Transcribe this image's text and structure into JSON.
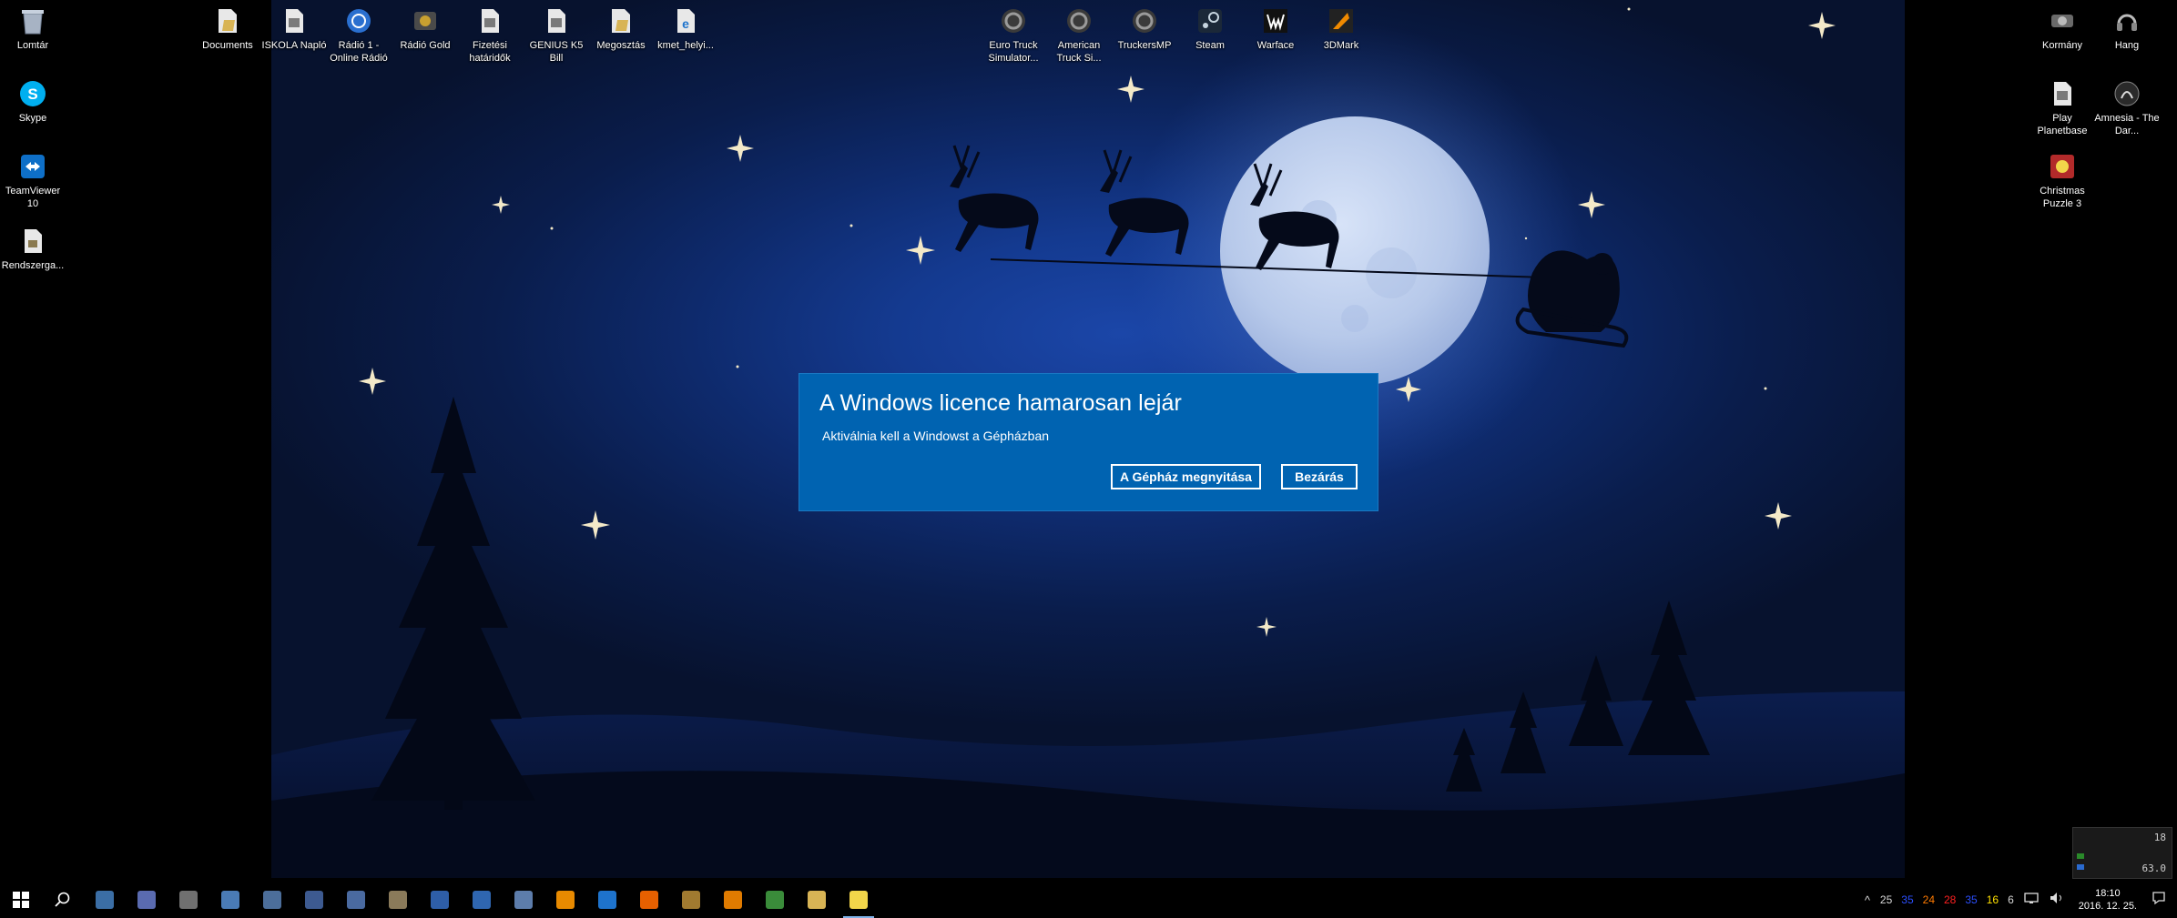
{
  "dialog": {
    "title": "A Windows licence hamarosan lejár",
    "message": "Aktiválnia kell a Windowst a Gépházban",
    "open_settings_label": "A Gépház megnyitása",
    "close_label": "Bezárás",
    "bg_color": "#0063b1"
  },
  "desktop_icons_left": [
    {
      "label": "Lomtár",
      "icon": "recycle-bin-icon"
    },
    {
      "label": "Skype",
      "icon": "skype-icon"
    },
    {
      "label": "TeamViewer 10",
      "icon": "teamviewer-icon"
    },
    {
      "label": "Rendszerga...",
      "icon": "shortcut-icon"
    }
  ],
  "desktop_icons_top": [
    {
      "label": "Documents",
      "icon": "folder-icon"
    },
    {
      "label": "ISKOLA Napló",
      "icon": "document-icon"
    },
    {
      "label": "Rádió 1 - Online Rádió",
      "icon": "radio-icon"
    },
    {
      "label": "Rádió Gold",
      "icon": "radio-icon"
    },
    {
      "label": "Fizetési határidők",
      "icon": "document-icon"
    },
    {
      "label": "GENIUS K5 Bill",
      "icon": "document-icon"
    },
    {
      "label": "Megosztás",
      "icon": "folder-icon"
    },
    {
      "label": "kmet_helyi...",
      "icon": "web-document-icon"
    }
  ],
  "desktop_icons_games": [
    {
      "label": "Euro Truck Simulator...",
      "icon": "steam-game-icon"
    },
    {
      "label": "American Truck Si...",
      "icon": "steam-game-icon"
    },
    {
      "label": "TruckersMP",
      "icon": "steam-game-icon"
    },
    {
      "label": "Steam",
      "icon": "steam-icon"
    },
    {
      "label": "Warface",
      "icon": "warface-icon"
    },
    {
      "label": "3DMark",
      "icon": "3dmark-icon"
    }
  ],
  "desktop_icons_right": [
    {
      "label": "Kormány",
      "icon": "steering-wheel-icon"
    },
    {
      "label": "Hang",
      "icon": "headset-icon"
    },
    {
      "label": "Play Planetbase",
      "icon": "document-icon"
    },
    {
      "label": "Amnesia - The Dar...",
      "icon": "amnesia-icon"
    },
    {
      "label": "Christmas Puzzle 3",
      "icon": "christmas-puzzle-icon"
    }
  ],
  "taskbar": {
    "apps": [
      {
        "name": "file-explorer-app",
        "color": "#3b6ea5"
      },
      {
        "name": "save-app",
        "color": "#5a6bb0"
      },
      {
        "name": "calculator-app",
        "color": "#707070"
      },
      {
        "name": "control-panel-app",
        "color": "#4a7bb5"
      },
      {
        "name": "pictures-app",
        "color": "#4c6e9a"
      },
      {
        "name": "gallery-app",
        "color": "#3d5a90"
      },
      {
        "name": "photos-app",
        "color": "#4a6aa0"
      },
      {
        "name": "archive-app",
        "color": "#8a7a5a"
      },
      {
        "name": "dictionary-app",
        "color": "#2e5ea8"
      },
      {
        "name": "music-app",
        "color": "#2f66b0"
      },
      {
        "name": "disk-app",
        "color": "#5d7dab"
      },
      {
        "name": "vlc-app",
        "color": "#e88a00"
      },
      {
        "name": "edge-app",
        "color": "#1e73cc"
      },
      {
        "name": "firefox-app",
        "color": "#e66000"
      },
      {
        "name": "gimp-app",
        "color": "#a07a30"
      },
      {
        "name": "avast-app",
        "color": "#e07b00"
      },
      {
        "name": "chrome-app",
        "color": "#3a8c3a"
      },
      {
        "name": "folder-app",
        "color": "#d8b455"
      },
      {
        "name": "sticky-notes-app",
        "color": "#f2d64a"
      }
    ],
    "tray_numbers": [
      {
        "value": "25",
        "color": "#d8d8d8"
      },
      {
        "value": "35",
        "color": "#2b4fff"
      },
      {
        "value": "24",
        "color": "#ff7a00"
      },
      {
        "value": "28",
        "color": "#ff2020"
      },
      {
        "value": "35",
        "color": "#2b4fff"
      },
      {
        "value": "16",
        "color": "#ffe000"
      },
      {
        "value": "6",
        "color": "#d8d8d8"
      }
    ],
    "clock_time": "18:10",
    "clock_date": "2016. 12. 25."
  },
  "hw_widget": {
    "line1": "18",
    "line2": "63.0"
  }
}
